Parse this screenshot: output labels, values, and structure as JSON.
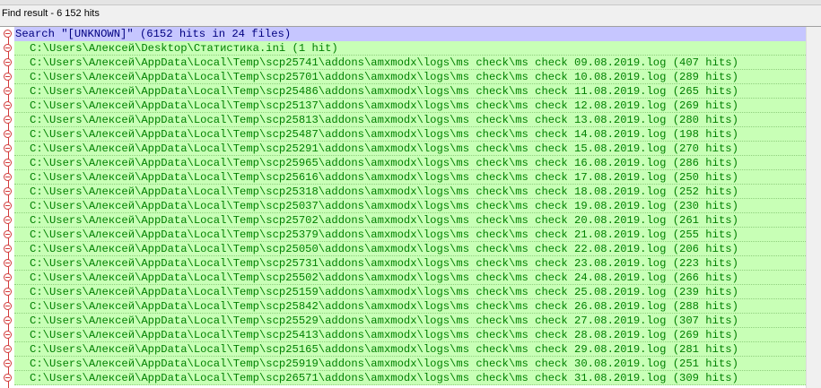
{
  "panel": {
    "title": "Find result - 6 152 hits"
  },
  "search_line": "Search \"[UNKNOWN]\" (6152 hits in 24 files)",
  "files": [
    "C:\\Users\\Алексей\\Desktop\\Статистика.ini (1 hit)",
    "C:\\Users\\Алексей\\AppData\\Local\\Temp\\scp25741\\addons\\amxmodx\\logs\\ms check\\ms check 09.08.2019.log (407 hits)",
    "C:\\Users\\Алексей\\AppData\\Local\\Temp\\scp25701\\addons\\amxmodx\\logs\\ms check\\ms check 10.08.2019.log (289 hits)",
    "C:\\Users\\Алексей\\AppData\\Local\\Temp\\scp25486\\addons\\amxmodx\\logs\\ms check\\ms check 11.08.2019.log (265 hits)",
    "C:\\Users\\Алексей\\AppData\\Local\\Temp\\scp25137\\addons\\amxmodx\\logs\\ms check\\ms check 12.08.2019.log (269 hits)",
    "C:\\Users\\Алексей\\AppData\\Local\\Temp\\scp25813\\addons\\amxmodx\\logs\\ms check\\ms check 13.08.2019.log (280 hits)",
    "C:\\Users\\Алексей\\AppData\\Local\\Temp\\scp25487\\addons\\amxmodx\\logs\\ms check\\ms check 14.08.2019.log (198 hits)",
    "C:\\Users\\Алексей\\AppData\\Local\\Temp\\scp25291\\addons\\amxmodx\\logs\\ms check\\ms check 15.08.2019.log (270 hits)",
    "C:\\Users\\Алексей\\AppData\\Local\\Temp\\scp25965\\addons\\amxmodx\\logs\\ms check\\ms check 16.08.2019.log (286 hits)",
    "C:\\Users\\Алексей\\AppData\\Local\\Temp\\scp25616\\addons\\amxmodx\\logs\\ms check\\ms check 17.08.2019.log (250 hits)",
    "C:\\Users\\Алексей\\AppData\\Local\\Temp\\scp25318\\addons\\amxmodx\\logs\\ms check\\ms check 18.08.2019.log (252 hits)",
    "C:\\Users\\Алексей\\AppData\\Local\\Temp\\scp25037\\addons\\amxmodx\\logs\\ms check\\ms check 19.08.2019.log (230 hits)",
    "C:\\Users\\Алексей\\AppData\\Local\\Temp\\scp25702\\addons\\amxmodx\\logs\\ms check\\ms check 20.08.2019.log (261 hits)",
    "C:\\Users\\Алексей\\AppData\\Local\\Temp\\scp25379\\addons\\amxmodx\\logs\\ms check\\ms check 21.08.2019.log (255 hits)",
    "C:\\Users\\Алексей\\AppData\\Local\\Temp\\scp25050\\addons\\amxmodx\\logs\\ms check\\ms check 22.08.2019.log (206 hits)",
    "C:\\Users\\Алексей\\AppData\\Local\\Temp\\scp25731\\addons\\amxmodx\\logs\\ms check\\ms check 23.08.2019.log (223 hits)",
    "C:\\Users\\Алексей\\AppData\\Local\\Temp\\scp25502\\addons\\amxmodx\\logs\\ms check\\ms check 24.08.2019.log (266 hits)",
    "C:\\Users\\Алексей\\AppData\\Local\\Temp\\scp25159\\addons\\amxmodx\\logs\\ms check\\ms check 25.08.2019.log (239 hits)",
    "C:\\Users\\Алексей\\AppData\\Local\\Temp\\scp25842\\addons\\amxmodx\\logs\\ms check\\ms check 26.08.2019.log (288 hits)",
    "C:\\Users\\Алексей\\AppData\\Local\\Temp\\scp25529\\addons\\amxmodx\\logs\\ms check\\ms check 27.08.2019.log (307 hits)",
    "C:\\Users\\Алексей\\AppData\\Local\\Temp\\scp25413\\addons\\amxmodx\\logs\\ms check\\ms check 28.08.2019.log (269 hits)",
    "C:\\Users\\Алексей\\AppData\\Local\\Temp\\scp25165\\addons\\amxmodx\\logs\\ms check\\ms check 29.08.2019.log (281 hits)",
    "C:\\Users\\Алексей\\AppData\\Local\\Temp\\scp25919\\addons\\amxmodx\\logs\\ms check\\ms check 30.08.2019.log (251 hits)",
    "C:\\Users\\Алексей\\AppData\\Local\\Temp\\scp26571\\addons\\amxmodx\\logs\\ms check\\ms check 31.08.2019.log (309 hits)"
  ],
  "colors": {
    "search_bg": "#c6c6ff",
    "search_text": "#000080",
    "file_bg": "#c8ffb6",
    "file_text": "#008000",
    "fold_marker": "#d23a3a"
  },
  "icons": {
    "fold_marker": "minus-circle-icon"
  }
}
